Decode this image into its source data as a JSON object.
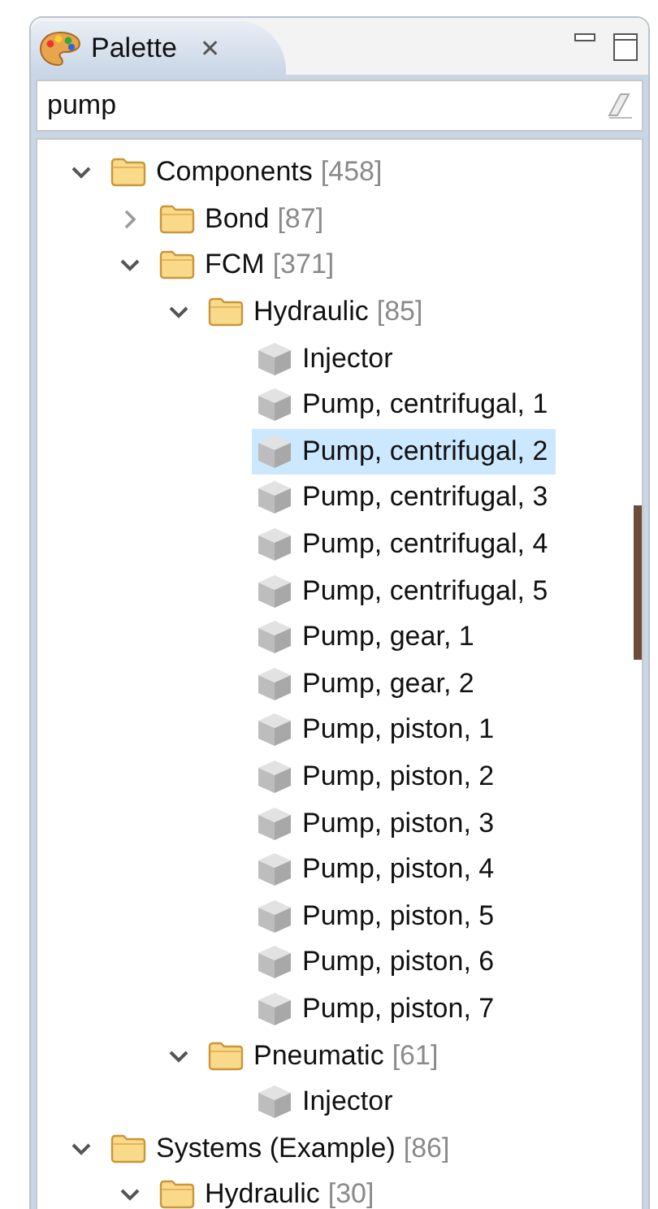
{
  "view": {
    "title": "Palette",
    "close": "✕"
  },
  "search": {
    "value": "pump"
  },
  "tree": [
    {
      "kind": "folder",
      "label": "Components",
      "count": "[458]",
      "expanded": true,
      "selected": false,
      "children": [
        {
          "kind": "folder",
          "label": "Bond",
          "count": "[87]",
          "expanded": false,
          "selected": false
        },
        {
          "kind": "folder",
          "label": "FCM",
          "count": "[371]",
          "expanded": true,
          "selected": false,
          "children": [
            {
              "kind": "folder",
              "label": "Hydraulic",
              "count": "[85]",
              "expanded": true,
              "selected": false,
              "children": [
                {
                  "kind": "item",
                  "label": "Injector",
                  "selected": false
                },
                {
                  "kind": "item",
                  "label": "Pump, centrifugal, 1",
                  "selected": false
                },
                {
                  "kind": "item",
                  "label": "Pump, centrifugal, 2",
                  "selected": true
                },
                {
                  "kind": "item",
                  "label": "Pump, centrifugal, 3",
                  "selected": false
                },
                {
                  "kind": "item",
                  "label": "Pump, centrifugal, 4",
                  "selected": false
                },
                {
                  "kind": "item",
                  "label": "Pump, centrifugal, 5",
                  "selected": false
                },
                {
                  "kind": "item",
                  "label": "Pump, gear, 1",
                  "selected": false
                },
                {
                  "kind": "item",
                  "label": "Pump, gear, 2",
                  "selected": false
                },
                {
                  "kind": "item",
                  "label": "Pump, piston, 1",
                  "selected": false
                },
                {
                  "kind": "item",
                  "label": "Pump, piston, 2",
                  "selected": false
                },
                {
                  "kind": "item",
                  "label": "Pump, piston, 3",
                  "selected": false
                },
                {
                  "kind": "item",
                  "label": "Pump, piston, 4",
                  "selected": false
                },
                {
                  "kind": "item",
                  "label": "Pump, piston, 5",
                  "selected": false
                },
                {
                  "kind": "item",
                  "label": "Pump, piston, 6",
                  "selected": false
                },
                {
                  "kind": "item",
                  "label": "Pump, piston, 7",
                  "selected": false
                }
              ]
            },
            {
              "kind": "folder",
              "label": "Pneumatic",
              "count": "[61]",
              "expanded": true,
              "selected": false,
              "children": [
                {
                  "kind": "item",
                  "label": "Injector",
                  "selected": false
                }
              ]
            }
          ]
        }
      ]
    },
    {
      "kind": "folder",
      "label": "Systems (Example)",
      "count": "[86]",
      "expanded": true,
      "selected": false,
      "children": [
        {
          "kind": "folder",
          "label": "Hydraulic",
          "count": "[30]",
          "expanded": true,
          "selected": false
        }
      ]
    }
  ]
}
